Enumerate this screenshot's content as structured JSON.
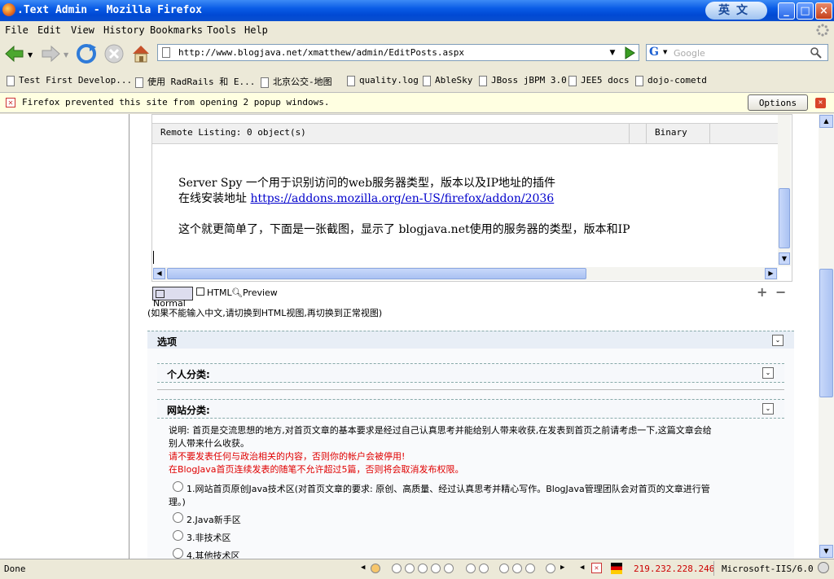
{
  "window": {
    "title": ".Text Admin - Mozilla Firefox",
    "ime_label": "英文",
    "minimize": "_",
    "maximize": "□",
    "close": "×"
  },
  "menu": [
    "File",
    "Edit",
    "View",
    "History",
    "Bookmarks",
    "Tools",
    "Help"
  ],
  "address": {
    "url": "http://www.blogjava.net/xmatthew/admin/EditPosts.aspx",
    "search_engine": "G",
    "search_placeholder": "Google"
  },
  "bookmarks": [
    "Test First Develop...",
    "使用 RadRails 和 E...",
    "北京公交-地图",
    "quality.log",
    "AbleSky",
    "JBoss jBPM 3.0",
    "JEE5 docs",
    "dojo-cometd"
  ],
  "popup_bar": {
    "message": "Firefox prevented this site from opening 2 popup windows.",
    "options_label": "Options"
  },
  "editor": {
    "remote_listing": "Remote Listing: 0 object(s)",
    "binary_label": "Binary",
    "line1": "Server Spy 一个用于识别访问的web服务器类型，版本以及IP地址的插件",
    "line2_prefix": "在线安装地址 ",
    "line2_link": "https://addons.mozilla.org/en-US/firefox/addon/2036",
    "line3": "这个就更简单了，下面是一张截图，显示了 blogjava.net使用的服务器的类型，版本和IP",
    "mode_normal": "Normal",
    "mode_html": "HTML",
    "mode_preview": "Preview",
    "hint": "(如果不能输入中文,请切换到HTML视图,再切换到正常视图)"
  },
  "options_section": {
    "title": "选项",
    "personal_category": "个人分类:",
    "site_category": "网站分类:",
    "description": "说明: 首页是交流思想的地方,对首页文章的基本要求是经过自己认真思考并能给别人带来收获,在发表到首页之前请考虑一下,这篇文章会给",
    "description2": "别人带来什么收获。",
    "warning1": "请不要发表任何与政治相关的内容，否则你的帐户会被停用!",
    "warning2": "在BlogJava首页连续发表的随笔不允许超过5篇，否则将会取消发布权限。",
    "options": [
      "1.网站首页原创Java技术区(对首页文章的要求: 原创、高质量、经过认真思考并精心写作。BlogJava管理团队会对首页的文章进行管",
      "2.Java新手区",
      "3.非技术区",
      "4.其他技术区"
    ],
    "option1_cont": "理。)"
  },
  "status": {
    "left": "Done",
    "ip": "219.232.228.246",
    "server": "Microsoft-IIS/6.0"
  },
  "colors": {
    "link": "#0000cc",
    "warning": "#e00000",
    "ip": "#cc0000"
  }
}
